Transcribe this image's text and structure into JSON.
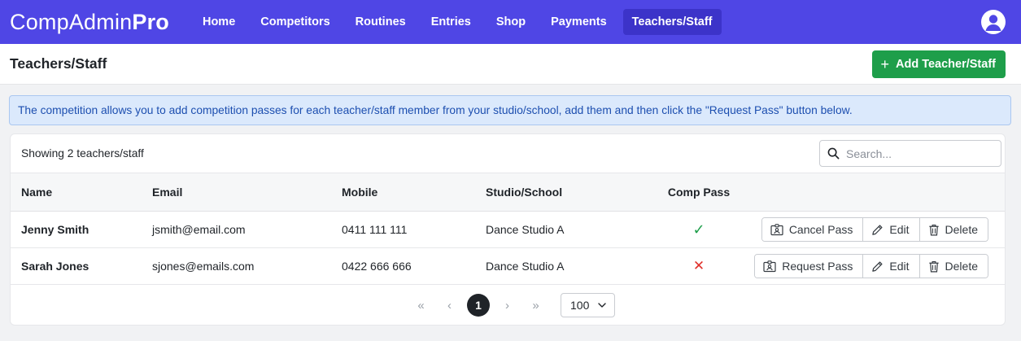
{
  "app": {
    "brand_regular": "CompAdmin",
    "brand_bold": "Pro"
  },
  "nav": {
    "items": [
      {
        "label": "Home"
      },
      {
        "label": "Competitors"
      },
      {
        "label": "Routines"
      },
      {
        "label": "Entries"
      },
      {
        "label": "Shop"
      },
      {
        "label": "Payments"
      },
      {
        "label": "Teachers/Staff",
        "active": true
      }
    ]
  },
  "header": {
    "title": "Teachers/Staff",
    "add_button": "Add Teacher/Staff"
  },
  "alert": {
    "text": "The competition allows you to add competition passes for each teacher/staff member from your studio/school, add them and then click the \"Request Pass\" button below."
  },
  "table": {
    "count_text": "Showing 2 teachers/staff",
    "search_placeholder": "Search...",
    "columns": [
      "Name",
      "Email",
      "Mobile",
      "Studio/School",
      "Comp Pass"
    ],
    "rows": [
      {
        "name": "Jenny Smith",
        "email": "jsmith@email.com",
        "mobile": "0411 111 111",
        "studio": "Dance Studio A",
        "pass_icon": "✓",
        "pass_action": "Cancel Pass",
        "edit": "Edit",
        "delete": "Delete"
      },
      {
        "name": "Sarah Jones",
        "email": "sjones@emails.com",
        "mobile": "0422 666 666",
        "studio": "Dance Studio A",
        "pass_icon": "✕",
        "pass_action": "Request Pass",
        "edit": "Edit",
        "delete": "Delete"
      }
    ]
  },
  "pagination": {
    "first": "«",
    "prev": "‹",
    "current": "1",
    "next": "›",
    "last": "»",
    "page_size": "100"
  },
  "icons": {
    "user": "user-circle-icon",
    "plus": "plus-icon",
    "search": "search-icon",
    "pass": "id-badge-icon",
    "edit": "pencil-icon",
    "delete": "trash-icon",
    "yes": "check-icon",
    "no": "x-icon"
  },
  "colors": {
    "navbar": "#4f46e5",
    "primary_action": "#1e9e4a",
    "alert_bg": "#dbe9fc",
    "alert_text": "#1d4fb0",
    "yes": "#1e9e4a",
    "no": "#e0312b"
  }
}
